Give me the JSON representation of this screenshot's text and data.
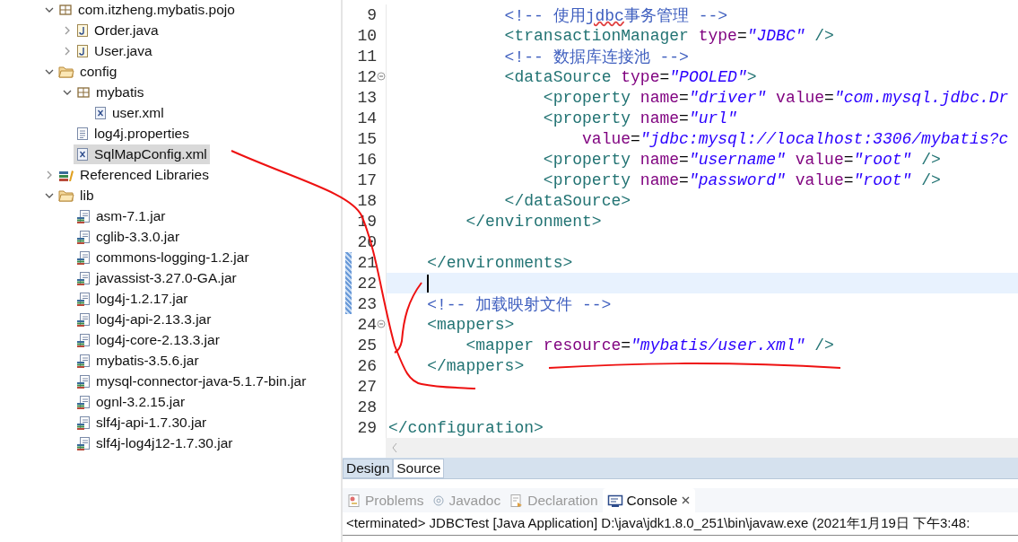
{
  "tree": [
    {
      "label": "com.itzheng.mybatis.pojo",
      "kind": "package",
      "expanded": true,
      "children": [
        {
          "label": "Order.java",
          "kind": "java",
          "expanded": false
        },
        {
          "label": "User.java",
          "kind": "java",
          "expanded": false
        }
      ]
    },
    {
      "label": "config",
      "kind": "folder",
      "expanded": true,
      "children": [
        {
          "label": "mybatis",
          "kind": "package",
          "expanded": true,
          "children": [
            {
              "label": "user.xml",
              "kind": "xml"
            }
          ]
        },
        {
          "label": "log4j.properties",
          "kind": "properties"
        },
        {
          "label": "SqlMapConfig.xml",
          "kind": "xml",
          "selected": true
        }
      ]
    },
    {
      "label": "Referenced Libraries",
      "kind": "library",
      "expanded": false
    },
    {
      "label": "lib",
      "kind": "folder",
      "expanded": true,
      "children": [
        {
          "label": "asm-7.1.jar",
          "kind": "jar"
        },
        {
          "label": "cglib-3.3.0.jar",
          "kind": "jar"
        },
        {
          "label": "commons-logging-1.2.jar",
          "kind": "jar"
        },
        {
          "label": "javassist-3.27.0-GA.jar",
          "kind": "jar"
        },
        {
          "label": "log4j-1.2.17.jar",
          "kind": "jar"
        },
        {
          "label": "log4j-api-2.13.3.jar",
          "kind": "jar"
        },
        {
          "label": "log4j-core-2.13.3.jar",
          "kind": "jar"
        },
        {
          "label": "mybatis-3.5.6.jar",
          "kind": "jar"
        },
        {
          "label": "mysql-connector-java-5.1.7-bin.jar",
          "kind": "jar"
        },
        {
          "label": "ognl-3.2.15.jar",
          "kind": "jar"
        },
        {
          "label": "slf4j-api-1.7.30.jar",
          "kind": "jar"
        },
        {
          "label": "slf4j-log4j12-1.7.30.jar",
          "kind": "jar"
        }
      ]
    }
  ],
  "editor": {
    "lines": [
      {
        "number": "9",
        "tokens": [
          {
            "kind": "comment",
            "text": "            <!-- 使用"
          },
          {
            "kind": "misspelled",
            "text": "jdbc"
          },
          {
            "kind": "comment",
            "text": "事务管理 -->"
          }
        ]
      },
      {
        "number": "10",
        "tokens": [
          {
            "kind": "tag",
            "text": "            <transactionManager"
          },
          {
            "kind": "attr",
            "text": " type"
          },
          {
            "kind": "punct",
            "text": "="
          },
          {
            "kind": "string",
            "text": "\"JDBC\""
          },
          {
            "kind": "tag",
            "text": " />"
          }
        ]
      },
      {
        "number": "11",
        "tokens": [
          {
            "kind": "comment",
            "text": "            <!-- 数据库连接池 -->"
          }
        ]
      },
      {
        "number": "12",
        "fold": true,
        "tokens": [
          {
            "kind": "tag",
            "text": "            <dataSource"
          },
          {
            "kind": "attr",
            "text": " type"
          },
          {
            "kind": "punct",
            "text": "="
          },
          {
            "kind": "string",
            "text": "\"POOLED\""
          },
          {
            "kind": "tag",
            "text": ">"
          }
        ]
      },
      {
        "number": "13",
        "tokens": [
          {
            "kind": "tag",
            "text": "                <property"
          },
          {
            "kind": "attr",
            "text": " name"
          },
          {
            "kind": "punct",
            "text": "="
          },
          {
            "kind": "string",
            "text": "\"driver\""
          },
          {
            "kind": "attr",
            "text": " value"
          },
          {
            "kind": "punct",
            "text": "="
          },
          {
            "kind": "string",
            "text": "\"com.mysql.jdbc.Dr"
          }
        ]
      },
      {
        "number": "14",
        "tokens": [
          {
            "kind": "tag",
            "text": "                <property"
          },
          {
            "kind": "attr",
            "text": " name"
          },
          {
            "kind": "punct",
            "text": "="
          },
          {
            "kind": "string",
            "text": "\"url\""
          }
        ]
      },
      {
        "number": "15",
        "tokens": [
          {
            "kind": "attr",
            "text": "                    value"
          },
          {
            "kind": "punct",
            "text": "="
          },
          {
            "kind": "string",
            "text": "\"jdbc:mysql://localhost:3306/mybatis?c"
          }
        ]
      },
      {
        "number": "16",
        "tokens": [
          {
            "kind": "tag",
            "text": "                <property"
          },
          {
            "kind": "attr",
            "text": " name"
          },
          {
            "kind": "punct",
            "text": "="
          },
          {
            "kind": "string",
            "text": "\"username\""
          },
          {
            "kind": "attr",
            "text": " value"
          },
          {
            "kind": "punct",
            "text": "="
          },
          {
            "kind": "string",
            "text": "\"root\""
          },
          {
            "kind": "tag",
            "text": " />"
          }
        ]
      },
      {
        "number": "17",
        "tokens": [
          {
            "kind": "tag",
            "text": "                <property"
          },
          {
            "kind": "attr",
            "text": " name"
          },
          {
            "kind": "punct",
            "text": "="
          },
          {
            "kind": "string",
            "text": "\"password\""
          },
          {
            "kind": "attr",
            "text": " value"
          },
          {
            "kind": "punct",
            "text": "="
          },
          {
            "kind": "string",
            "text": "\"root\""
          },
          {
            "kind": "tag",
            "text": " />"
          }
        ]
      },
      {
        "number": "18",
        "tokens": [
          {
            "kind": "tag",
            "text": "            </dataSource>"
          }
        ]
      },
      {
        "number": "19",
        "tokens": [
          {
            "kind": "tag",
            "text": "        </environment>"
          }
        ]
      },
      {
        "number": "20"
      },
      {
        "number": "21",
        "changed": true,
        "tokens": [
          {
            "kind": "tag",
            "text": "    </environments>"
          }
        ]
      },
      {
        "number": "22",
        "changed": true,
        "current": true
      },
      {
        "number": "23",
        "changed": true,
        "tokens": [
          {
            "kind": "comment",
            "text": "    <!-- 加载映射文件 -->"
          }
        ]
      },
      {
        "number": "24",
        "fold": true,
        "tokens": [
          {
            "kind": "tag",
            "text": "    <mappers>"
          }
        ]
      },
      {
        "number": "25",
        "tokens": [
          {
            "kind": "tag",
            "text": "        <mapper"
          },
          {
            "kind": "attr",
            "text": " resource"
          },
          {
            "kind": "punct",
            "text": "="
          },
          {
            "kind": "string",
            "text": "\"mybatis/user.xml\""
          },
          {
            "kind": "tag",
            "text": " />"
          }
        ]
      },
      {
        "number": "26",
        "tokens": [
          {
            "kind": "tag",
            "text": "    </mappers>"
          }
        ]
      },
      {
        "number": "27"
      },
      {
        "number": "28"
      },
      {
        "number": "29",
        "tokens": [
          {
            "kind": "tag",
            "text": "</configuration>"
          }
        ]
      }
    ]
  },
  "editor_tabs": [
    {
      "label": "Design",
      "selected": false
    },
    {
      "label": "Source",
      "selected": true
    }
  ],
  "console_tabs": [
    {
      "label": "Problems",
      "kind": "problems",
      "selected": false
    },
    {
      "label": "Javadoc",
      "kind": "javadoc",
      "selected": false
    },
    {
      "label": "Declaration",
      "kind": "declaration",
      "selected": false
    },
    {
      "label": "Console",
      "kind": "console",
      "selected": true
    }
  ],
  "console": {
    "text": "<terminated> JDBCTest [Java Application] D:\\java\\jdk1.8.0_251\\bin\\javaw.exe (2021年1月19日 下午3:48:"
  }
}
